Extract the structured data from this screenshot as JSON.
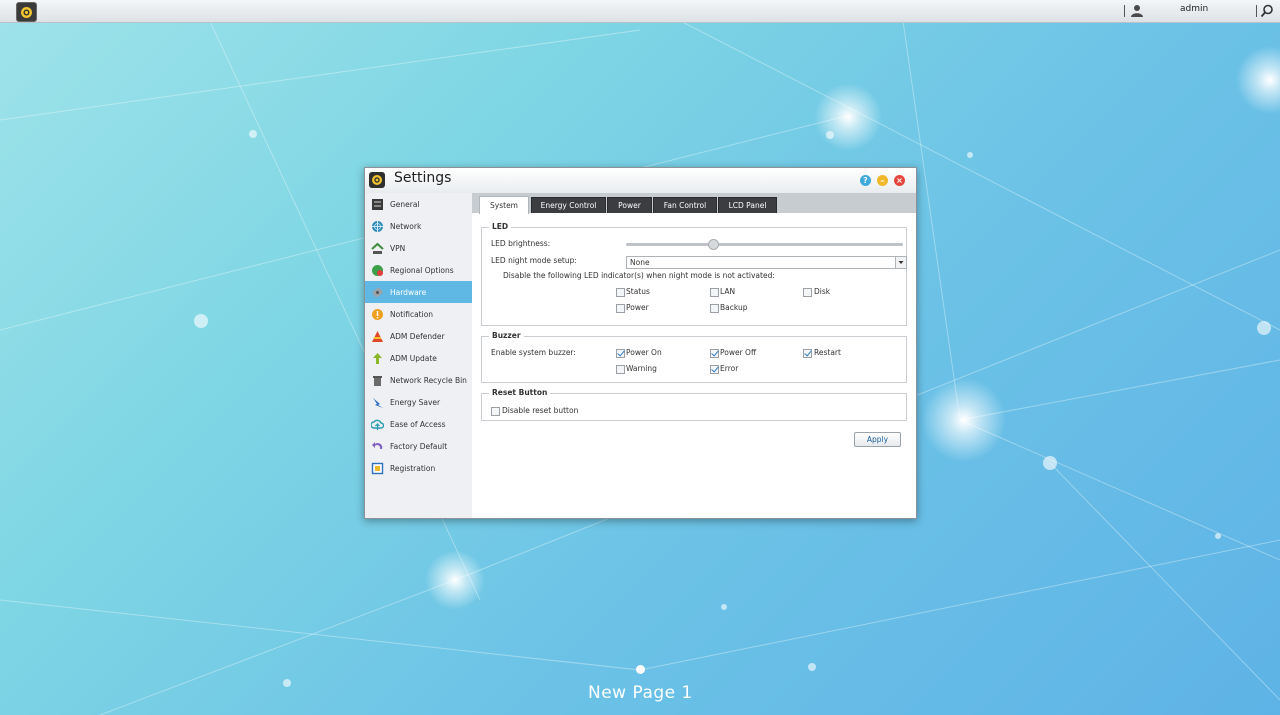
{
  "topbar": {
    "user_name": "admin"
  },
  "window": {
    "title": "Settings"
  },
  "sidebar": {
    "items": [
      {
        "label": "General",
        "icon": "general-icon"
      },
      {
        "label": "Network",
        "icon": "network-icon"
      },
      {
        "label": "VPN",
        "icon": "vpn-icon"
      },
      {
        "label": "Regional Options",
        "icon": "regional-icon"
      },
      {
        "label": "Hardware",
        "icon": "hardware-icon",
        "active": true
      },
      {
        "label": "Notification",
        "icon": "notification-icon"
      },
      {
        "label": "ADM Defender",
        "icon": "defender-icon"
      },
      {
        "label": "ADM Update",
        "icon": "update-icon"
      },
      {
        "label": "Network Recycle Bin",
        "icon": "recycle-bin-icon"
      },
      {
        "label": "Energy Saver",
        "icon": "energy-saver-icon"
      },
      {
        "label": "Ease of Access",
        "icon": "cloud-access-icon"
      },
      {
        "label": "Factory Default",
        "icon": "factory-default-icon"
      },
      {
        "label": "Registration",
        "icon": "registration-icon"
      }
    ]
  },
  "tabs": [
    {
      "label": "System",
      "active": true
    },
    {
      "label": "Energy Control"
    },
    {
      "label": "Power"
    },
    {
      "label": "Fan Control"
    },
    {
      "label": "LCD Panel"
    }
  ],
  "led": {
    "legend": "LED",
    "brightness_label": "LED brightness:",
    "brightness_value": 0.31,
    "night_mode_label": "LED night mode setup:",
    "night_mode_value": "None",
    "disable_text": "Disable the following LED indicator(s) when night mode is not activated:",
    "indicators": [
      {
        "label": "Status",
        "checked": false
      },
      {
        "label": "LAN",
        "checked": false
      },
      {
        "label": "Disk",
        "checked": false
      },
      {
        "label": "Power",
        "checked": false
      },
      {
        "label": "Backup",
        "checked": false
      }
    ]
  },
  "buzzer": {
    "legend": "Buzzer",
    "enable_label": "Enable system buzzer:",
    "options": [
      {
        "label": "Power On",
        "checked": true
      },
      {
        "label": "Power Off",
        "checked": true
      },
      {
        "label": "Restart",
        "checked": true
      },
      {
        "label": "Warning",
        "checked": false
      },
      {
        "label": "Error",
        "checked": true
      }
    ]
  },
  "reset": {
    "legend": "Reset Button",
    "disable_label": "Disable reset button",
    "checked": false
  },
  "apply_label": "Apply",
  "desktop": {
    "page_label": "New Page 1"
  }
}
